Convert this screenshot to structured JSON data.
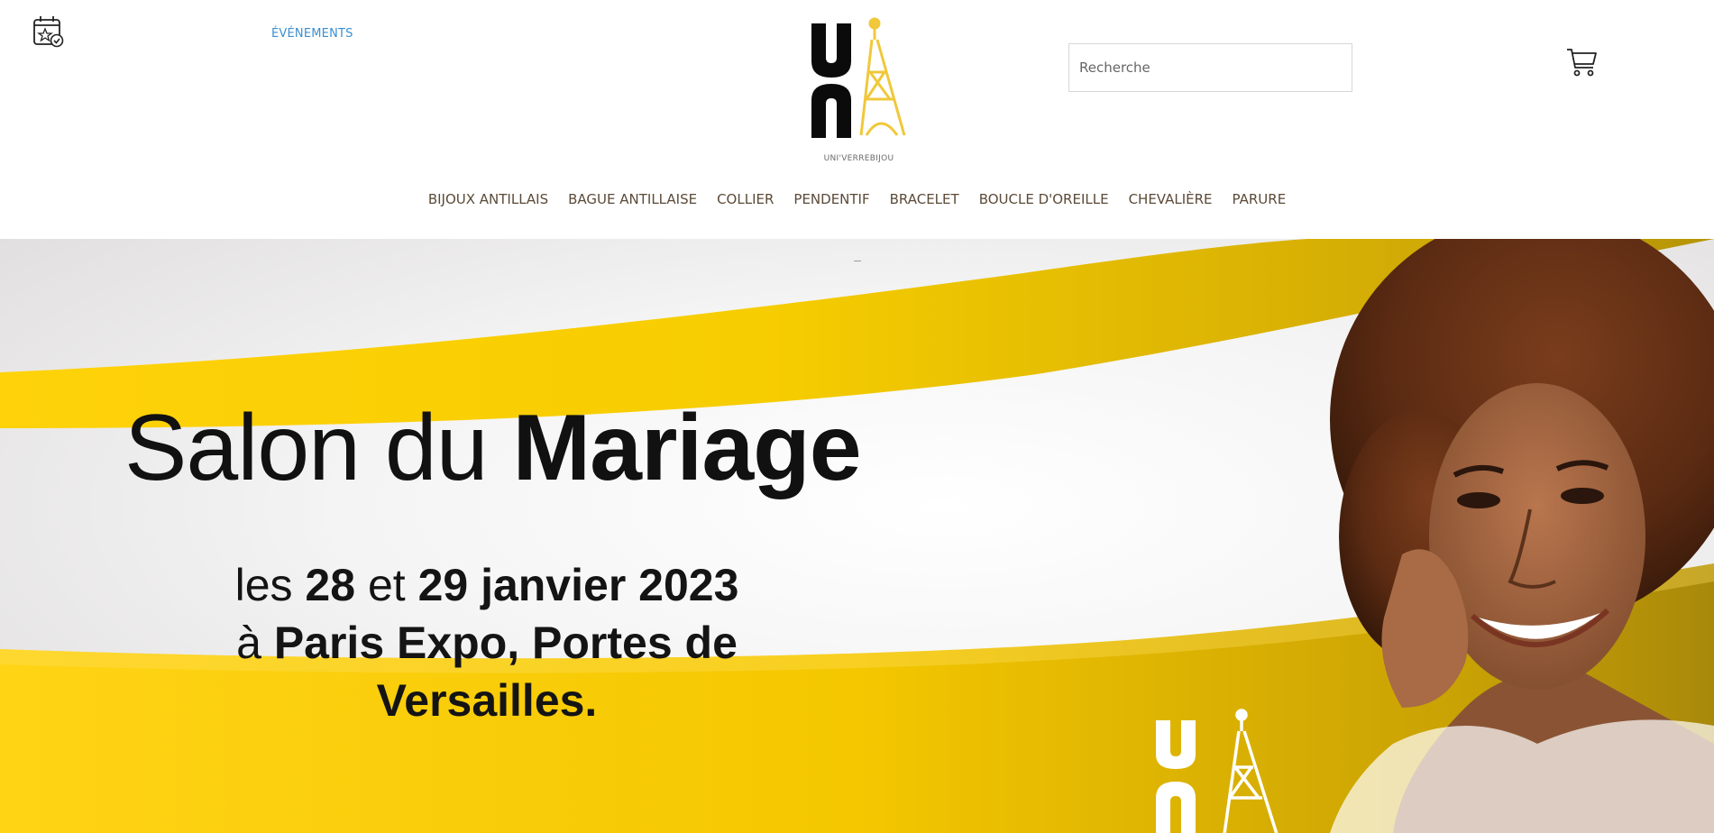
{
  "header": {
    "events_label": "ÉVÉNEMENTS",
    "logo_caption": "UNI'VERREBIJOU",
    "search_placeholder": "Recherche"
  },
  "nav": {
    "items": [
      "BIJOUX ANTILLAIS",
      "BAGUE ANTILLAISE",
      "COLLIER",
      "PENDENTIF",
      "BRACELET",
      "BOUCLE D'OREILLE",
      "CHEVALIÈRE",
      "PARURE"
    ]
  },
  "hero": {
    "title_light": "Salon du",
    "title_bold": "Mariage",
    "line1_a": "les",
    "line1_b": "28",
    "line1_c": "et",
    "line1_d": "29 janvier 2023",
    "line2_a": "à",
    "line2_b": "Paris Expo, Portes de",
    "line3": "Versailles."
  },
  "icons": {
    "events": "calendar-star-icon",
    "cart": "shopping-cart-icon",
    "logo": "eiffel-tower-logo"
  },
  "colors": {
    "brand_gold": "#f0c800",
    "link_blue": "#3b8fd1",
    "nav_text": "#5b4a38"
  }
}
